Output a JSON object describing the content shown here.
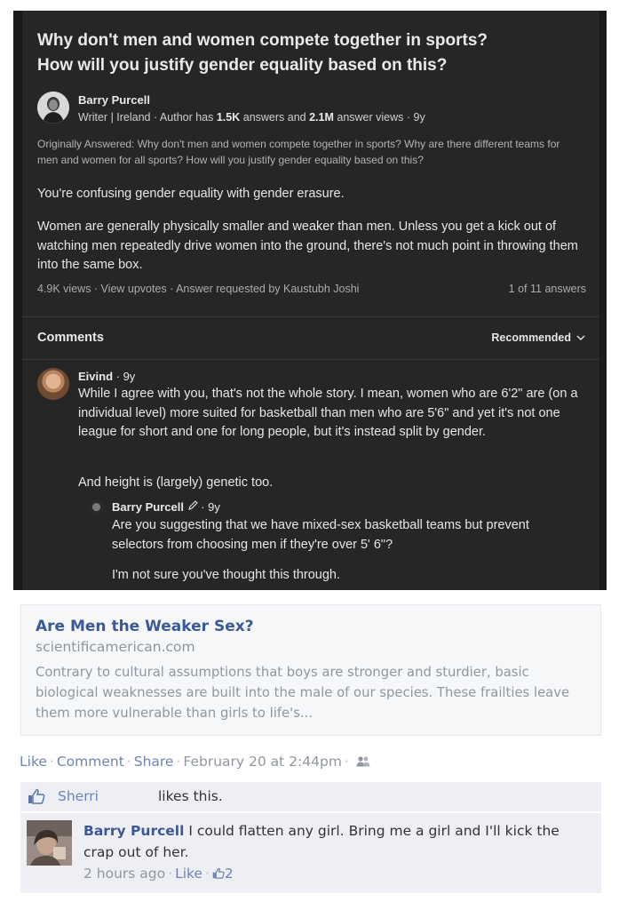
{
  "quora": {
    "question_title_line1": "Why don't men and women compete together in sports?",
    "question_title_line2": "How will you justify gender equality based on this?",
    "author": {
      "name": "Barry Purcell",
      "cred_prefix": "Writer | Ireland · Author has ",
      "answers": "1.5K",
      "cred_mid": " answers and ",
      "views": "2.1M",
      "cred_suffix": " answer views · 9y"
    },
    "originally_answered": "Originally Answered: Why don't men and women compete together in sports? Why are there different teams for men and women for all sports? How will you justify gender equality based on this?",
    "answer_p1": "You're confusing gender equality with gender erasure.",
    "answer_p2": "Women are generally physically smaller and weaker than men. Unless you get a kick out of watching men repeatedly drive women into the ground, there's not much point in throwing them into the same box.",
    "stats": "4.9K views · View upvotes · Answer requested by Kaustubh Joshi",
    "answers_count": "1 of 11 answers",
    "comments_heading": "Comments",
    "sort_label": "Recommended",
    "comment1": {
      "name": "Eivind",
      "meta": " · 9y",
      "text": "While I agree with you, that's not the whole story. I mean, women who are 6'2\" are (on a individual level) more suited for basketball than men who are 5'6\" and yet it's not one league for short and one for long people, but it's instead split by gender.",
      "text2": "And height is (largely) genetic too."
    },
    "reply1": {
      "name": "Barry Purcell",
      "meta": " · 9y",
      "text": "Are you suggesting that we have mixed-sex basketball teams but prevent selectors from choosing men if they're over 5' 6\"?",
      "text2": "I'm not sure you've thought this through."
    }
  },
  "facebook": {
    "link": {
      "title": "Are Men the Weaker Sex?",
      "domain": "scientificamerican.com",
      "description": "Contrary to cultural assumptions that boys are stronger and sturdier, basic biological weaknesses are built into the male of our species. These frailties leave them more vulnerable than girls to life's..."
    },
    "actions": {
      "like": "Like",
      "comment": "Comment",
      "share": "Share",
      "date": "February 20 at 2:44pm"
    },
    "likes": {
      "name": "Sherri",
      "text": "likes this."
    },
    "comment": {
      "name": "Barry Purcell",
      "text": " I could flatten any girl. Bring me a girl and I'll kick the crap out of her.",
      "time": "2 hours ago",
      "like": "Like",
      "like_count": "2"
    }
  },
  "colors": {
    "quora_bg": "#262626",
    "fb_link": "#3b5998",
    "fb_light_link": "#6d84b4",
    "fb_row_bg": "#edeff4"
  }
}
